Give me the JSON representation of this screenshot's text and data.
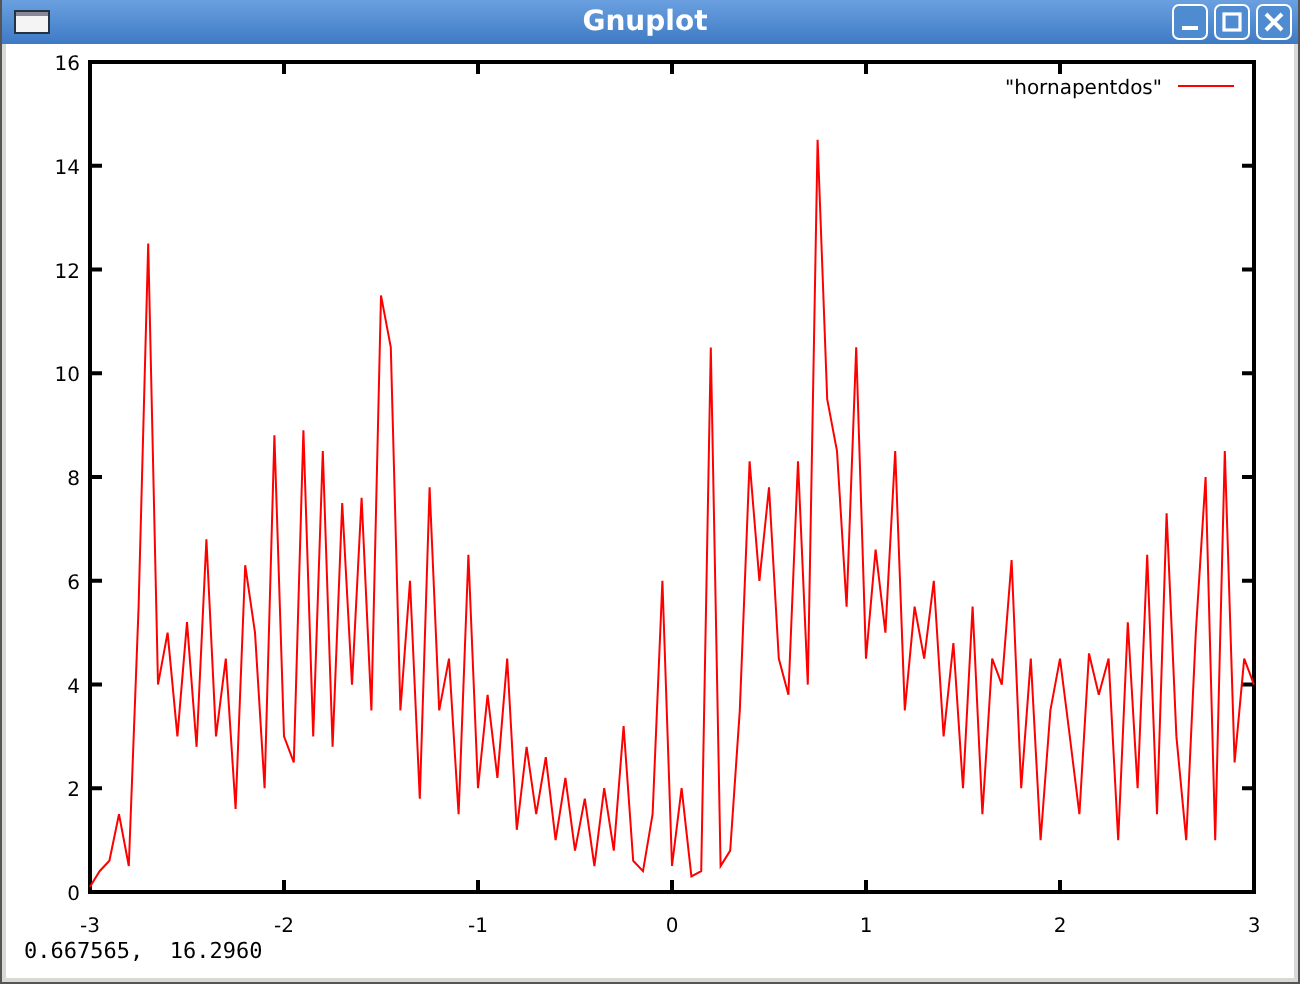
{
  "window": {
    "title": "Gnuplot"
  },
  "plot": {
    "chart_data": {
      "type": "line",
      "xlim": [
        -3,
        3
      ],
      "ylim": [
        0,
        16
      ],
      "xticks": [
        -3,
        -2,
        -1,
        0,
        1,
        2,
        3
      ],
      "yticks": [
        0,
        2,
        4,
        6,
        8,
        10,
        12,
        14,
        16
      ],
      "x": [
        -3,
        -2.95,
        -2.9,
        -2.85,
        -2.8,
        -2.75,
        -2.7,
        -2.65,
        -2.6,
        -2.55,
        -2.5,
        -2.45,
        -2.4,
        -2.35,
        -2.3,
        -2.25,
        -2.2,
        -2.15,
        -2.1,
        -2.05,
        -2,
        -1.95,
        -1.9,
        -1.85,
        -1.8,
        -1.75,
        -1.7,
        -1.65,
        -1.6,
        -1.55,
        -1.5,
        -1.45,
        -1.4,
        -1.35,
        -1.3,
        -1.25,
        -1.2,
        -1.15,
        -1.1,
        -1.05,
        -1,
        -0.95,
        -0.9,
        -0.85,
        -0.8,
        -0.75,
        -0.7,
        -0.65,
        -0.6,
        -0.55,
        -0.5,
        -0.45,
        -0.4,
        -0.35,
        -0.3,
        -0.25,
        -0.2,
        -0.15,
        -0.1,
        -0.05,
        0,
        0.05,
        0.1,
        0.15,
        0.2,
        0.25,
        0.3,
        0.35,
        0.4,
        0.45,
        0.5,
        0.55,
        0.6,
        0.65,
        0.7,
        0.75,
        0.8,
        0.85,
        0.9,
        0.95,
        1,
        1.05,
        1.1,
        1.15,
        1.2,
        1.25,
        1.3,
        1.35,
        1.4,
        1.45,
        1.5,
        1.55,
        1.6,
        1.65,
        1.7,
        1.75,
        1.8,
        1.85,
        1.9,
        1.95,
        2,
        2.05,
        2.1,
        2.15,
        2.2,
        2.25,
        2.3,
        2.35,
        2.4,
        2.45,
        2.5,
        2.55,
        2.6,
        2.65,
        2.7,
        2.75,
        2.8,
        2.85,
        2.9,
        2.95,
        3
      ],
      "series": [
        {
          "name": "\"hornapentdos\"",
          "color": "#ff0000",
          "values": [
            0.1,
            0.4,
            0.6,
            1.5,
            0.5,
            5.5,
            12.5,
            4.0,
            5.0,
            3.0,
            5.2,
            2.8,
            6.8,
            3.0,
            4.5,
            1.6,
            6.3,
            5.0,
            2.0,
            8.8,
            3.0,
            2.5,
            8.9,
            3.0,
            8.5,
            2.8,
            7.5,
            4.0,
            7.6,
            3.5,
            11.5,
            10.5,
            3.5,
            6.0,
            1.8,
            7.8,
            3.5,
            4.5,
            1.5,
            6.5,
            2.0,
            3.8,
            2.2,
            4.5,
            1.2,
            2.8,
            1.5,
            2.6,
            1.0,
            2.2,
            0.8,
            1.8,
            0.5,
            2.0,
            0.8,
            3.2,
            0.6,
            0.4,
            1.5,
            6.0,
            0.5,
            2.0,
            0.3,
            0.4,
            10.5,
            0.5,
            0.8,
            3.5,
            8.3,
            6.0,
            7.8,
            4.5,
            3.8,
            8.3,
            4.0,
            14.5,
            9.5,
            8.5,
            5.5,
            10.5,
            4.5,
            6.6,
            5.0,
            8.5,
            3.5,
            5.5,
            4.5,
            6.0,
            3.0,
            4.8,
            2.0,
            5.5,
            1.5,
            4.5,
            4.0,
            6.4,
            2.0,
            4.5,
            1.0,
            3.5,
            4.5,
            3.0,
            1.5,
            4.6,
            3.8,
            4.5,
            1.0,
            5.2,
            2.0,
            6.5,
            1.5,
            7.3,
            3.0,
            1.0,
            5.0,
            8.0,
            1.0,
            8.5,
            2.5,
            4.5,
            4.0
          ]
        }
      ]
    }
  },
  "status_bar": "0.667565,  16.2960"
}
